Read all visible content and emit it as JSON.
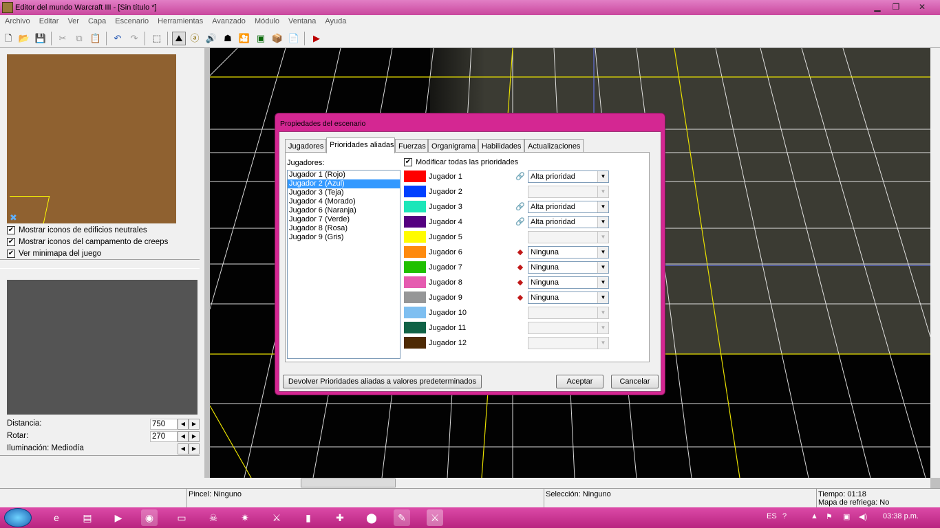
{
  "window": {
    "title": "Editor del mundo Warcraft III - [Sin título *]",
    "min": "▁",
    "max": "❐",
    "close": "✕"
  },
  "menu": [
    "Archivo",
    "Editar",
    "Ver",
    "Capa",
    "Escenario",
    "Herramientas",
    "Avanzado",
    "Módulo",
    "Ventana",
    "Ayuda"
  ],
  "toolbar": {
    "new": "🗋",
    "open": "📂",
    "save": "💾",
    "cut": "✂",
    "copy": "⧉",
    "paste": "📋",
    "undo": "↶",
    "redo": "↷",
    "select": "⬚",
    "terrain": "⛰",
    "doodads": "ⓐ",
    "units": "🔊",
    "regions": "☗",
    "cameras": "🎦",
    "sounds": "▣",
    "objects": "📦",
    "scripts": "📄",
    "test": "▶"
  },
  "left": {
    "checkboxes": [
      {
        "label": "Mostrar iconos de edificios neutrales",
        "checked": "✔"
      },
      {
        "label": "Mostrar iconos del campamento de creeps",
        "checked": "✔"
      },
      {
        "label": "Ver minimapa del juego",
        "checked": "✔"
      }
    ],
    "distance_label": "Distancia:",
    "distance_value": "750",
    "rotate_label": "Rotar:",
    "rotate_value": "270",
    "lighting_label": "Iluminación: Mediodía",
    "left_arrow": "◀",
    "right_arrow": "▶"
  },
  "status": {
    "brush": "Pincel: Ninguno",
    "selection": "Selección: Ninguno",
    "time": "Tiempo: 01:18",
    "refresh": "Mapa de refriega: No"
  },
  "dialog": {
    "title": "Propiedades del escenario",
    "tabs": [
      "Jugadores",
      "Prioridades aliadas",
      "Fuerzas",
      "Organigrama",
      "Habilidades",
      "Actualizaciones"
    ],
    "players_label": "Jugadores:",
    "player_list": [
      "Jugador 1 (Rojo)",
      "Jugador 2 (Azul)",
      "Jugador 3 (Teja)",
      "Jugador 4 (Morado)",
      "Jugador 6 (Naranja)",
      "Jugador 7 (Verde)",
      "Jugador 8 (Rosa)",
      "Jugador 9 (Gris)"
    ],
    "modify_all": "Modificar todas las prioridades",
    "modify_check": "✔",
    "rows": [
      {
        "name": "Jugador 1",
        "color": "#ff0000",
        "icon": "🔗",
        "priority": "Alta prioridad"
      },
      {
        "name": "Jugador 2",
        "color": "#0040ff",
        "icon": "",
        "priority": ""
      },
      {
        "name": "Jugador 3",
        "color": "#1ce6b9",
        "icon": "🔗",
        "priority": "Alta prioridad"
      },
      {
        "name": "Jugador 4",
        "color": "#540081",
        "icon": "🔗",
        "priority": "Alta prioridad"
      },
      {
        "name": "Jugador 5",
        "color": "#fffc00",
        "icon": "",
        "priority": ""
      },
      {
        "name": "Jugador 6",
        "color": "#fe8a0e",
        "icon": "◆",
        "priority": "Ninguna"
      },
      {
        "name": "Jugador 7",
        "color": "#20c000",
        "icon": "◆",
        "priority": "Ninguna"
      },
      {
        "name": "Jugador 8",
        "color": "#e55bb0",
        "icon": "◆",
        "priority": "Ninguna"
      },
      {
        "name": "Jugador 9",
        "color": "#959697",
        "icon": "◆",
        "priority": "Ninguna"
      },
      {
        "name": "Jugador 10",
        "color": "#7ebff1",
        "icon": "",
        "priority": ""
      },
      {
        "name": "Jugador 11",
        "color": "#106246",
        "icon": "",
        "priority": ""
      },
      {
        "name": "Jugador 12",
        "color": "#4e2a04",
        "icon": "",
        "priority": ""
      }
    ],
    "dropdown_arrow": "▼",
    "reset_button": "Devolver Prioridades aliadas a valores predeterminados",
    "ok_button": "Aceptar",
    "cancel_button": "Cancelar"
  },
  "taskbar": {
    "lang": "ES",
    "clock": "03:38 p.m."
  }
}
